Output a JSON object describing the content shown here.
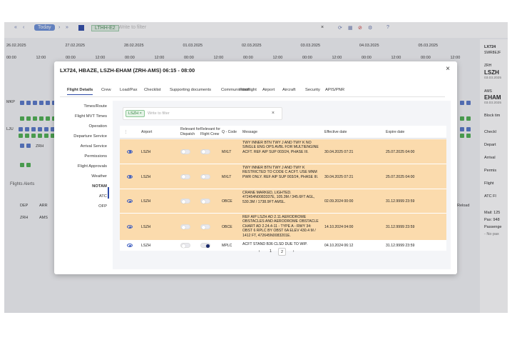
{
  "topbar": {
    "today": "Today",
    "timeline": "LTHH-E2",
    "filter_placeholder": "Write to filter"
  },
  "timeline": {
    "dates": [
      "26.02.2025",
      "27.02.2025",
      "28.02.2025",
      "01.03.2025",
      "02.03.2025",
      "03.03.2025",
      "04.03.2025",
      "05.03.2025"
    ],
    "hours": [
      "00:00",
      "12:00",
      "00:00",
      "12:00",
      "00:00",
      "12:00",
      "00:00",
      "12:00",
      "00:00",
      "12:00",
      "00:00",
      "12:00",
      "00:00",
      "12:00",
      "00:00",
      "12:00"
    ]
  },
  "background": {
    "flights_alerts": "Flights Alerts",
    "dep": "DEP",
    "arr": "ARR",
    "zrh": "ZRH",
    "ams": "AMS",
    "row_labels": [
      "MKP",
      "LJU",
      "ZRH"
    ],
    "reload": "Reload"
  },
  "right_panel": {
    "flight": "LX724",
    "reg": "SWR8EJF",
    "from": "ZRH",
    "from_city": "LSZH",
    "from_date": "03.03.2025",
    "to": "AMS",
    "to_city": "EHAM",
    "to_date": "03.03.2025",
    "block_time": "Block tim",
    "items": [
      "Checkl",
      "Depart",
      "Arrival",
      "Permis",
      "Flight",
      "ATC Fl"
    ],
    "mail": "Mail: 125",
    "pax": "Pax: 948",
    "passengers": "Passenge",
    "no_pax": "- No pax"
  },
  "modal": {
    "title": "LX724, HBAZE, LSZH-EHAM (ZRH-AMS) 06:15 - 08:00",
    "tabs": [
      "Flight Details",
      "Crew",
      "Load/Pax",
      "Checklist",
      "Supporting documents",
      "Communication",
      "Postflight",
      "Airport",
      "Aircraft",
      "Security",
      "APIS/PNR"
    ],
    "side_items": [
      "Times/Route",
      "Flight MVT Times",
      "Operation",
      "Departure Service",
      "Arrival Service",
      "Permissions",
      "Flight Approvals",
      "Weather",
      "NOTAM",
      "ATC",
      "OFP"
    ],
    "filter": {
      "tag": "LSZH",
      "placeholder": "Write to filter"
    },
    "columns": {
      "airport": "Airport",
      "dispatch": "Relevant for Dispatch",
      "crew": "Relevant for Flight Crew",
      "qcode": "Q - Code",
      "message": "Message",
      "effective": "Effective date",
      "expire": "Expire date"
    },
    "rows": [
      {
        "airport": "LSZH",
        "dispatch": false,
        "crew": false,
        "qcode": "MXLT",
        "message": "TWY INNER BTN TWY J AND TWY K NO SINGLE ENG OPS AVBL FOR MULTIENGINE ACFT. REF AIP SUP 003/24, PHASE III.",
        "effective": "30.04.2025 07:21",
        "expire": "25.07.2025 04:00",
        "highlight": true
      },
      {
        "airport": "LSZH",
        "dispatch": false,
        "crew": false,
        "qcode": "MXLT",
        "message": "TWY INNER BTN TWY J AND TWY K RESTRICTED TO CODE C ACFT. USE MNM PWR ONLY. REF AIP SUP 003/24, PHASE III.",
        "effective": "30.04.2025 07:21",
        "expire": "25.07.2025 04:00",
        "highlight": true
      },
      {
        "airport": "LSZH",
        "dispatch": false,
        "crew": false,
        "qcode": "OBCE",
        "message": "CRANE MARKED, LIGHTED. 472454N0083337E, 105.3M / 345.6FT AGL, 530.3M / 1738.9FT AMSL.",
        "effective": "02.09.2024 00:00",
        "expire": "31.12.9999 23:59",
        "highlight": true
      },
      {
        "airport": "LSZH",
        "dispatch": false,
        "crew": false,
        "qcode": "OBCE",
        "message": "REF AIP LSZH AD 2.11 AERODROME OBSTACLES AND AERODROME OBSTACLE CHART AD 2.24.4-11 - TYPE A - RWY 34: OBST 6 RPLC BY OBST 6A ELEV 430.4 M / 1412 FT, 472645N0083201E.",
        "effective": "14.10.2024 04:00",
        "expire": "31.12.9999 23:59",
        "highlight": true
      },
      {
        "airport": "LSZH",
        "dispatch": false,
        "crew": true,
        "qcode": "MPLC",
        "message": "ACFT STAND B36 CLSD DUE TO WIP.",
        "effective": "04.10.2024 06:12",
        "expire": "31.12.9999 23:59",
        "highlight": false
      }
    ],
    "pager": {
      "page1": "1",
      "page2": "2",
      "prev": "‹",
      "next": "›"
    },
    "close": "×"
  },
  "colors": {
    "highlight": "#fbdbad",
    "accent": "#2d4aa8",
    "green": "#4caf50"
  }
}
